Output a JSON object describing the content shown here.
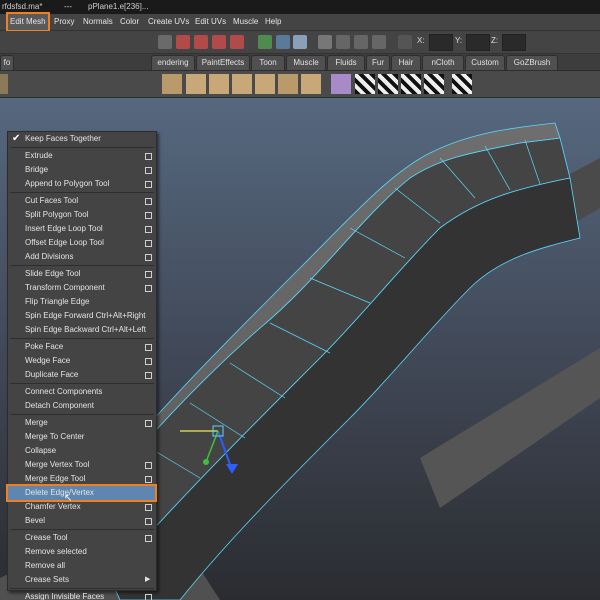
{
  "window": {
    "title_left": "rfdsfsd.ma*",
    "title_sep": "---",
    "title_obj": "pPlane1.e[236]..."
  },
  "menubar": [
    {
      "label": "Edit Mesh",
      "active": true
    },
    {
      "label": "Proxy"
    },
    {
      "label": "Normals"
    },
    {
      "label": "Color"
    },
    {
      "label": "Create UVs"
    },
    {
      "label": "Edit UVs"
    },
    {
      "label": "Muscle"
    },
    {
      "label": "Help"
    }
  ],
  "toolbar": {
    "x_label": "X:",
    "y_label": "Y:",
    "z_label": "Z:"
  },
  "shelf_tabs": [
    "fo",
    "endering",
    "PaintEffects",
    "Toon",
    "Muscle",
    "Fluids",
    "Fur",
    "Hair",
    "nCloth",
    "Custom",
    "GoZBrush"
  ],
  "edit_mesh_menu": {
    "items": [
      {
        "label": "Keep Faces Together",
        "check": true
      },
      {
        "sep": true
      },
      {
        "label": "Extrude",
        "box": true
      },
      {
        "label": "Bridge",
        "box": true
      },
      {
        "label": "Append to Polygon Tool",
        "box": true
      },
      {
        "sep": true
      },
      {
        "label": "Cut Faces Tool",
        "box": true
      },
      {
        "label": "Split Polygon Tool",
        "box": true
      },
      {
        "label": "Insert Edge Loop Tool",
        "box": true
      },
      {
        "label": "Offset Edge Loop Tool",
        "box": true
      },
      {
        "label": "Add Divisions",
        "box": true
      },
      {
        "sep": true
      },
      {
        "label": "Slide Edge Tool",
        "box": true
      },
      {
        "label": "Transform Component",
        "box": true
      },
      {
        "label": "Flip Triangle Edge"
      },
      {
        "label": "Spin Edge Forward  Ctrl+Alt+Right"
      },
      {
        "label": "Spin Edge Backward  Ctrl+Alt+Left"
      },
      {
        "sep": true
      },
      {
        "label": "Poke Face",
        "box": true
      },
      {
        "label": "Wedge Face",
        "box": true
      },
      {
        "label": "Duplicate Face",
        "box": true
      },
      {
        "sep": true
      },
      {
        "label": "Connect Components"
      },
      {
        "label": "Detach Component"
      },
      {
        "sep": true
      },
      {
        "label": "Merge",
        "box": true
      },
      {
        "label": "Merge To Center"
      },
      {
        "label": "Collapse"
      },
      {
        "label": "Merge Vertex Tool",
        "box": true
      },
      {
        "label": "Merge Edge Tool",
        "box": true
      },
      {
        "label": "Delete Edge/Vertex",
        "highlight": true
      },
      {
        "label": "Chamfer Vertex",
        "box": true
      },
      {
        "label": "Bevel",
        "box": true
      },
      {
        "sep": true
      },
      {
        "label": "Crease Tool",
        "box": true
      },
      {
        "label": "Remove selected"
      },
      {
        "label": "Remove all"
      },
      {
        "label": "Crease Sets",
        "submenu": true
      },
      {
        "sep": true
      },
      {
        "label": "Assign Invisible Faces",
        "box": true
      }
    ]
  },
  "colors": {
    "accent": "#f07f1e",
    "menu_bg": "#444444",
    "highlight": "#5f86b0",
    "viewport_top": "#5a6c82",
    "viewport_bottom": "#2a2c30",
    "wire": "#5ad9ff"
  }
}
